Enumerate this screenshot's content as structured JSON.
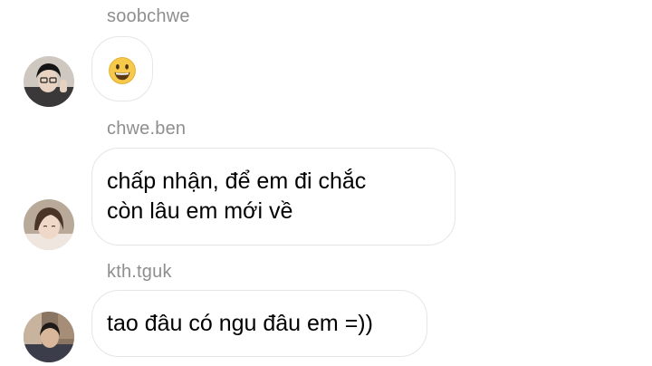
{
  "messages": [
    {
      "sender": "soobchwe",
      "avatar": "avatar-soobchwe",
      "type": "emoji",
      "emoji": "grinning-face-emoji",
      "text": ""
    },
    {
      "sender": "chwe.ben",
      "avatar": "avatar-chwe-ben",
      "type": "text",
      "text": "chấp nhận, để em đi chắc\ncòn lâu em mới về"
    },
    {
      "sender": "kth.tguk",
      "avatar": "avatar-kth-tguk",
      "type": "text",
      "text": "tao đâu có ngu đâu em =))"
    }
  ],
  "colors": {
    "background": "#ffffff",
    "sender_text": "#8e8e8e",
    "bubble_border": "#e6e6e6",
    "message_text": "#000000",
    "emoji_face": "#f7c94b"
  }
}
